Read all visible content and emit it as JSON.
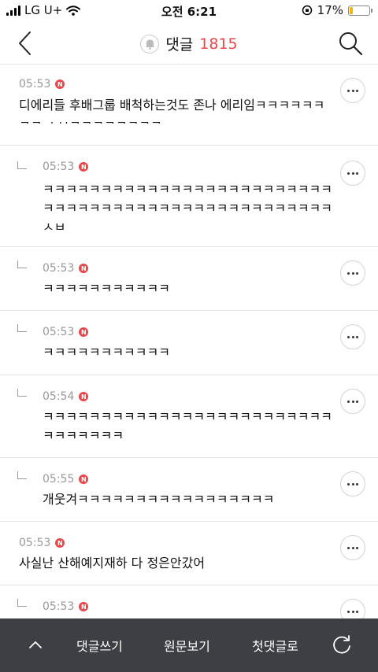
{
  "status_bar": {
    "carrier": "LG U+",
    "time": "오전 6:21",
    "battery_percent": "17%",
    "battery_level": 0.17,
    "battery_color": "#f5b800"
  },
  "header": {
    "title": "댓글",
    "count": "1815",
    "count_color": "#e8474c",
    "icons": [
      "back-arrow-icon",
      "bell-icon",
      "search-icon"
    ]
  },
  "comments": [
    {
      "time": "05:53",
      "badge": "N",
      "reply": false,
      "text": "디에리들 후배그룹 배척하는것도 존나 에리임ㅋㅋㅋㅋㅋㅋㅋㅋ ㅅㅂㅋㅋㅋㅋㅋㅋㅋㅋ"
    },
    {
      "time": "05:53",
      "badge": "N",
      "reply": true,
      "text": "ㅋㅋㅋㅋㅋㅋㅋㅋㅋㅋㅋㅋㅋㅋㅋㅋㅋㅋㅋㅋㅋㅋㅋㅋㅋㅋㅋㅋㅋㅋㅋㅋㅋㅋㅋㅋㅋㅋㅋㅋㅋㅋㅋㅋㅋㅋㅋㅋㅋㅋㅅㅂ"
    },
    {
      "time": "05:53",
      "badge": "N",
      "reply": true,
      "text": "ㅋㅋㅋㅋㅋㅋㅋㅋㅋㅋㅋ"
    },
    {
      "time": "05:53",
      "badge": "N",
      "reply": true,
      "text": "ㅋㅋㅋㅋㅋㅋㅋㅋㅋㅋㅋ"
    },
    {
      "time": "05:54",
      "badge": "N",
      "reply": true,
      "text": "ㅋㅋㅋㅋㅋㅋㅋㅋㅋㅋㅋㅋㅋㅋㅋㅋㅋㅋㅋㅋㅋㅋㅋㅋㅋㅋㅋㅋㅋㅋㅋㅋ"
    },
    {
      "time": "05:55",
      "badge": "N",
      "reply": true,
      "text": "개웃겨ㅋㅋㅋㅋㅋㅋㅋㅋㅋㅋㅋㅋㅋㅋㅋㅋㅋ"
    },
    {
      "time": "05:53",
      "badge": "N",
      "reply": false,
      "text": "사실난 산해예지재하 다 정은안갔어"
    },
    {
      "time": "05:53",
      "badge": "N",
      "reply": true,
      "text": ""
    }
  ],
  "bottom_bar": {
    "write": "댓글쓰기",
    "original": "원문보기",
    "first": "첫댓글로",
    "icons": [
      "chevron-up-icon",
      "refresh-icon"
    ]
  }
}
